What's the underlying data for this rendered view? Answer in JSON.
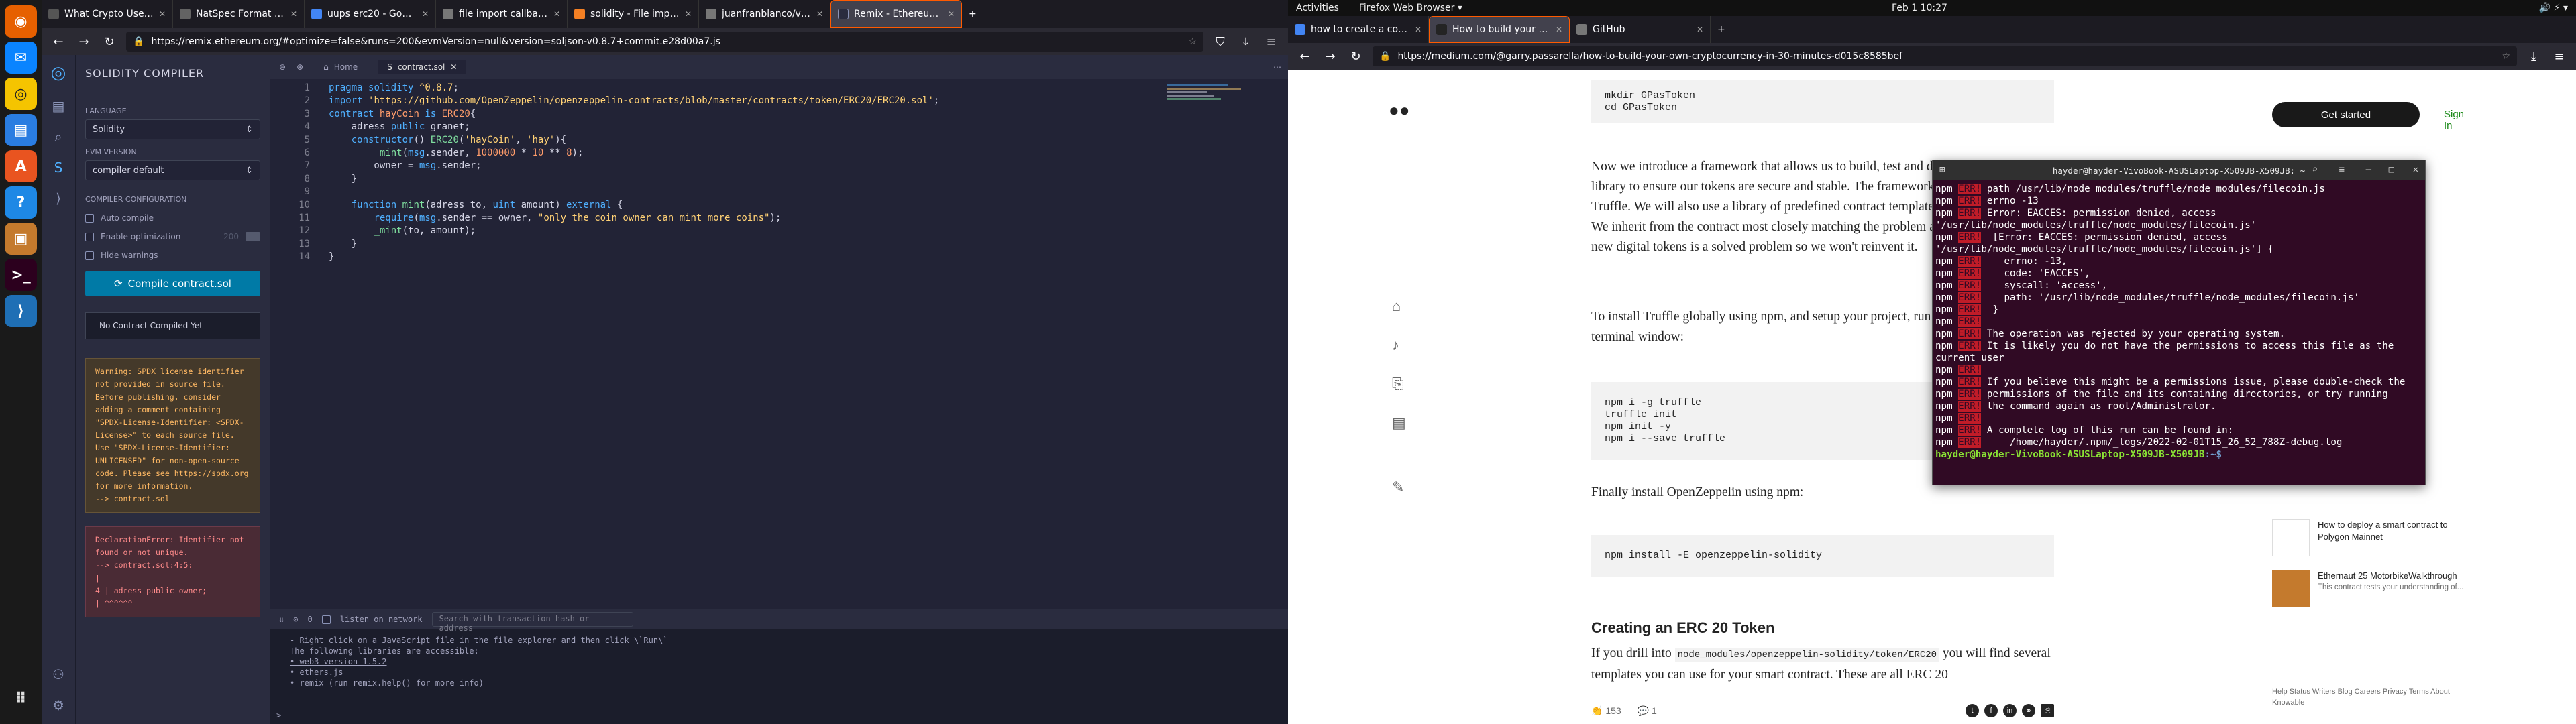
{
  "dock": {
    "apps": [
      "Firefox",
      "Thunderbird",
      "Rhythmbox",
      "LibreOffice Writer",
      "Ubuntu Software",
      "Help",
      "Packages",
      "Terminal",
      "VS Code"
    ]
  },
  "left_browser": {
    "tabs": [
      {
        "title": "What Crypto Users Need"
      },
      {
        "title": "NatSpec Format — Solidi"
      },
      {
        "title": "uups erc20 - Google Sea"
      },
      {
        "title": "file import callback not"
      },
      {
        "title": "solidity - File import cal"
      },
      {
        "title": "juanfranblanco/vscode-s"
      },
      {
        "title": "Remix - Ethereum IDE"
      }
    ],
    "url": "https://remix.ethereum.org/#optimize=false&runs=200&evmVersion=null&version=soljson-v0.8.7+commit.e28d00a7.js"
  },
  "remix": {
    "panel_title": "SOLIDITY COMPILER",
    "language_label": "LANGUAGE",
    "language_value": "Solidity",
    "evm_label": "EVM VERSION",
    "evm_value": "compiler default",
    "config_label": "COMPILER CONFIGURATION",
    "auto_compile": "Auto compile",
    "enable_opt": "Enable optimization",
    "runs_value": "200",
    "hide_warnings": "Hide warnings",
    "compile_button": "Compile contract.sol",
    "no_contract": "No Contract Compiled Yet",
    "warning": "Warning: SPDX license identifier not provided in source file. Before publishing, consider adding a comment containing \"SPDX-License-Identifier: <SPDX-License>\" to each source file. Use \"SPDX-License-Identifier: UNLICENSED\" for non-open-source code. Please see https://spdx.org for more information.\n--> contract.sol",
    "error": "DeclarationError: Identifier not found or not unique.\n--> contract.sol:4:5:\n|\n4 | adress public owner;\n| ^^^^^^",
    "tab_home": "Home",
    "tab_file": "contract.sol",
    "line_numbers": [
      "1",
      "2",
      "3",
      "4",
      "5",
      "6",
      "7",
      "8",
      "9",
      "10",
      "11",
      "12",
      "13",
      "14"
    ],
    "terminal_listen": "listen on network",
    "terminal_search": "Search with transaction hash or address",
    "terminal_lines": [
      "- Right click on a JavaScript file in the file explorer and then click \\`Run\\`",
      "",
      "The following libraries are accessible:",
      "• web3 version 1.5.2",
      "• ethers.js",
      "• remix (run remix.help() for more info)"
    ],
    "terminal_prompt": ">"
  },
  "right_browser": {
    "gnome_activities": "Activities",
    "gnome_app": "Firefox Web Browser ▾",
    "gnome_clock": "Feb 1  10:27",
    "tabs": [
      {
        "title": "how to create a coin usin"
      },
      {
        "title": "How to build your own c"
      },
      {
        "title": "GitHub"
      }
    ],
    "url": "https://medium.com/@garry.passarella/how-to-build-your-own-cryptocurrency-in-30-minutes-d015c8585bef"
  },
  "medium": {
    "code1": "mkdir GPasToken\ncd GPasToken",
    "p1": "Now we introduce a framework that allows us to build, test and deploy contracts, and a library to ensure our tokens are secure and stable. The framework we'll use is called Truffle. We will also use a library of predefined contract templates, called OpenZeppelin. We inherit from the contract most closely matching the problem at hand, in this case the new digital tokens is a solved problem so we won't reinvent it.",
    "p2": "To install Truffle globally using npm, and setup your project, run these commands in a terminal window:",
    "code2": "npm i -g truffle\ntruffle init\nnpm init -y\nnpm i --save truffle",
    "p3": "Finally install OpenZeppelin using npm:",
    "code3": "npm install -E openzeppelin-solidity",
    "h_erc20": "Creating an ERC 20 Token",
    "p4a": "If you drill into",
    "p4code": "node_modules/openzeppelin-solidity/token/ERC20",
    "p4b": "you will find several templates you can use for your smart contract. These are all ERC 20",
    "get_started": "Get started",
    "sign_in": "Sign In",
    "rec1_title": "How to deploy a smart contract to Polygon Mainnet",
    "rec2_title": "Ethernaut 25 MotorbikeWalkthrough",
    "rec2_sub": "This contract tests your understanding of...",
    "footer": "Help  Status  Writers  Blog  Careers  Privacy  Terms  About  Knowable",
    "claps": "153",
    "comments": "1"
  },
  "gterm": {
    "title": "hayder@hayder-VivoBook-ASUSLaptop-X509JB-X509JB: ~",
    "lines": [
      {
        "tag": "ERR!",
        "text": " path /usr/lib/node_modules/truffle/node_modules/filecoin.js"
      },
      {
        "tag": "ERR!",
        "text": " errno -13"
      },
      {
        "tag": "ERR!",
        "text": " Error: EACCES: permission denied, access '/usr/lib/node_modules/truffle/node_modules/filecoin.js'"
      },
      {
        "tag": "ERR!",
        "text": "  [Error: EACCES: permission denied, access '/usr/lib/node_modules/truffle/node_modules/filecoin.js'] {"
      },
      {
        "tag": "ERR!",
        "text": "    errno: -13,"
      },
      {
        "tag": "ERR!",
        "text": "    code: 'EACCES',"
      },
      {
        "tag": "ERR!",
        "text": "    syscall: 'access',"
      },
      {
        "tag": "ERR!",
        "text": "    path: '/usr/lib/node_modules/truffle/node_modules/filecoin.js'"
      },
      {
        "tag": "ERR!",
        "text": "  }"
      },
      {
        "tag": "ERR!",
        "text": ""
      },
      {
        "tag": "ERR!",
        "text": " The operation was rejected by your operating system."
      },
      {
        "tag": "ERR!",
        "text": " It is likely you do not have the permissions to access this file as the current user"
      },
      {
        "tag": "ERR!",
        "text": ""
      },
      {
        "tag": "ERR!",
        "text": " If you believe this might be a permissions issue, please double-check the"
      },
      {
        "tag": "ERR!",
        "text": " permissions of the file and its containing directories, or try running"
      },
      {
        "tag": "ERR!",
        "text": " the command again as root/Administrator."
      },
      {
        "tag": "ERR!",
        "text": ""
      },
      {
        "tag": "ERR!",
        "text": " A complete log of this run can be found in:"
      },
      {
        "tag": "ERR!",
        "text": "     /home/hayder/.npm/_logs/2022-02-01T15_26_52_788Z-debug.log"
      }
    ],
    "prompt_user": "hayder@hayder-VivoBook-ASUSLaptop-X509JB-X509JB",
    "prompt_dir": ":~$"
  }
}
